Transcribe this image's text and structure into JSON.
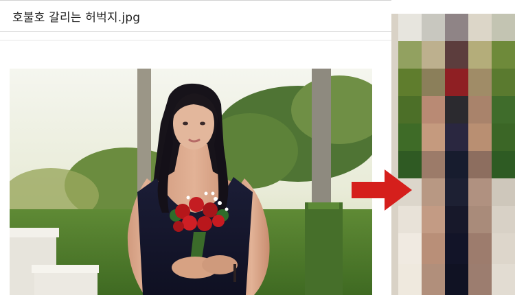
{
  "post": {
    "title": "호불호 갈리는 허벅지.jpg"
  },
  "photo": {
    "subject": "woman-holding-red-roses"
  },
  "censored": {
    "style": "pixelated"
  },
  "arrow": {
    "color": "#d51f1c",
    "icon": "arrow-right-icon"
  }
}
